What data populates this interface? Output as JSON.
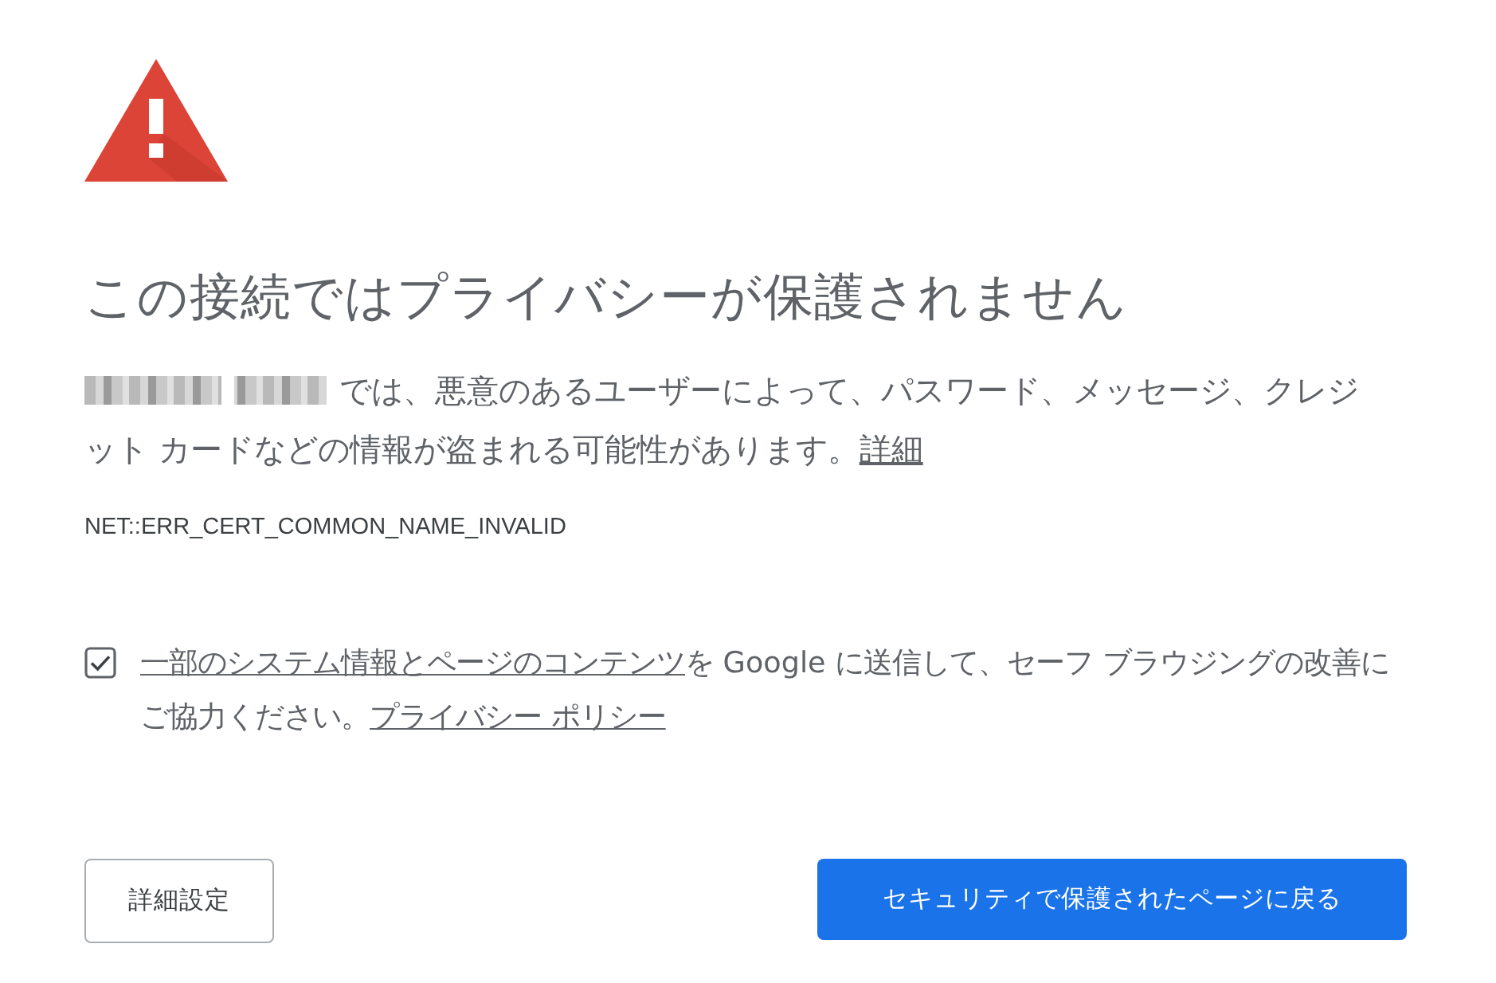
{
  "heading": "この接続ではプライバシーが保護されません",
  "message": {
    "text": "では、悪意のあるユーザーによって、パスワード、メッセージ、クレジット カードなどの情報が盗まれる可能性があります。",
    "link": "詳細"
  },
  "error_code": "NET::ERR_CERT_COMMON_NAME_INVALID",
  "safe_browsing": {
    "checked": true,
    "link": "一部のシステム情報とページのコンテンツ",
    "text": "を Google に送信して、セーフ ブラウジングの改善にご協力ください。",
    "policy_link": "プライバシー ポリシー"
  },
  "buttons": [
    {
      "label": "詳細設定",
      "kind": "secondary"
    },
    {
      "label": "セキュリティで保護されたページに戻る",
      "kind": "primary"
    }
  ]
}
